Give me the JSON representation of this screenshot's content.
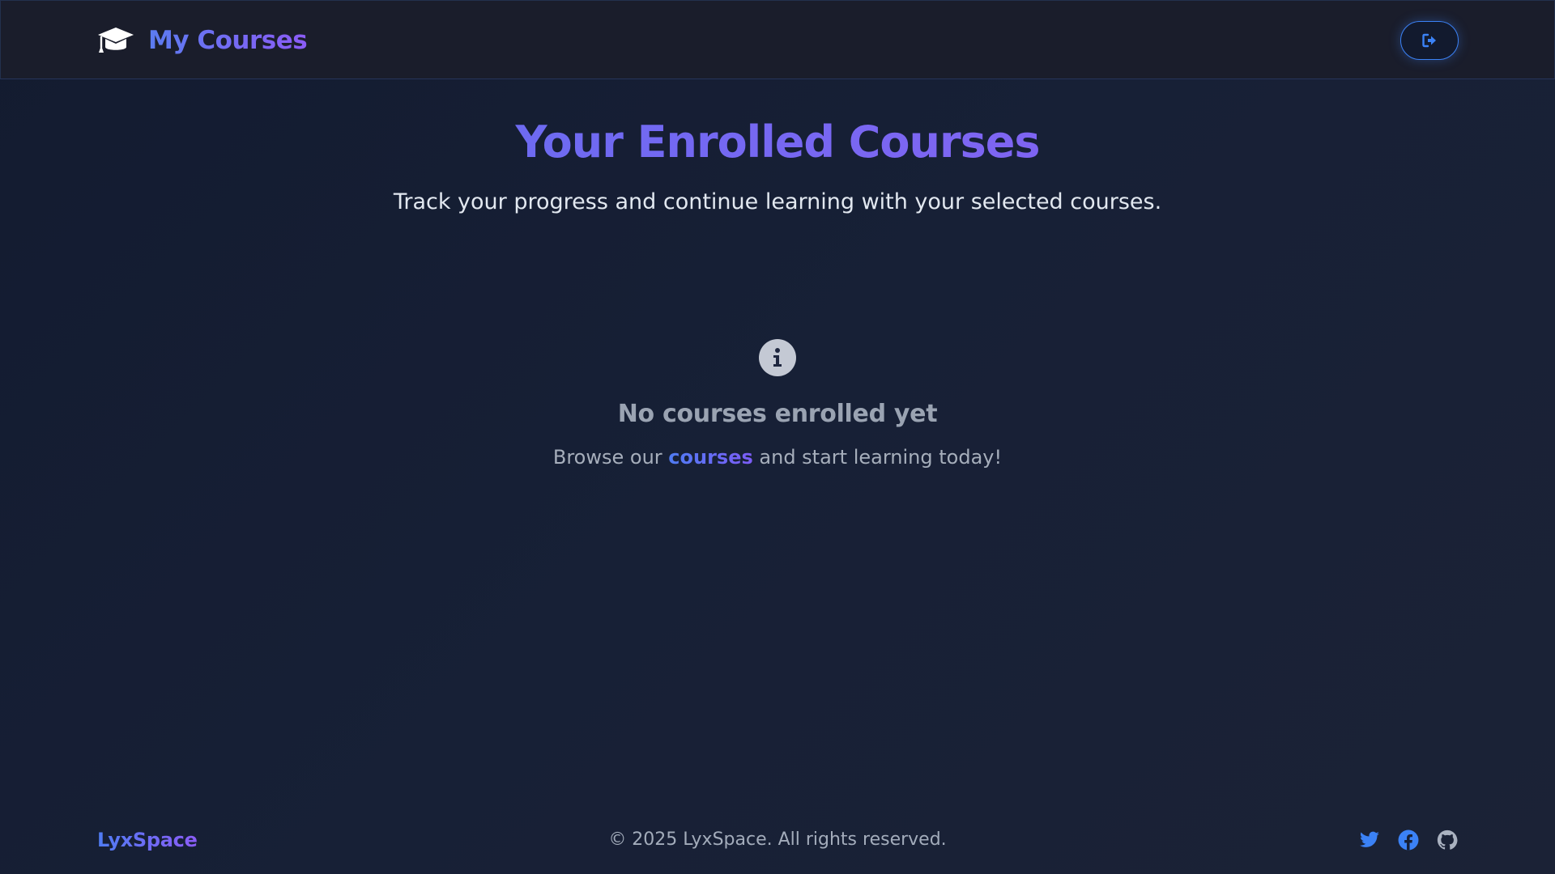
{
  "header": {
    "brand_icon": "graduation-cap-icon",
    "title": "My Courses",
    "logout_icon": "sign-out-icon"
  },
  "hero": {
    "title": "Your Enrolled Courses",
    "subtitle": "Track your progress and continue learning with your selected courses."
  },
  "empty_state": {
    "icon": "info-circle-icon",
    "title": "No courses enrolled yet",
    "text_before": "Browse our ",
    "link_label": "courses",
    "text_after": " and start learning today!"
  },
  "footer": {
    "brand": "LyxSpace",
    "copyright": "© 2025 LyxSpace. All rights reserved.",
    "socials": [
      {
        "icon": "twitter-icon"
      },
      {
        "icon": "facebook-icon"
      },
      {
        "icon": "github-icon"
      }
    ]
  },
  "colors": {
    "accent_blue": "#3b82f6",
    "accent_purple": "#8b5cf6",
    "background": "#151c30"
  }
}
